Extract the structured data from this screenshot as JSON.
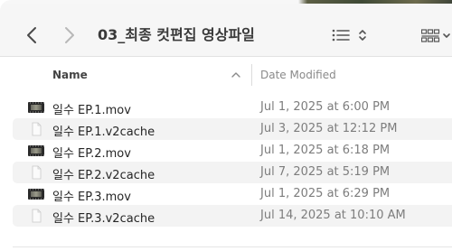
{
  "toolbar": {
    "title": "03_최종 컷편집 영상파일",
    "back_icon": "chevron-left-icon",
    "forward_icon": "chevron-right-icon",
    "list_view_icon": "list-view-icon",
    "sort_icon": "chevron-updown-icon",
    "gallery_view_icon": "gallery-view-icon"
  },
  "columns": {
    "name": "Name",
    "date_modified": "Date Modified",
    "sort_direction_icon": "chevron-up-icon"
  },
  "files": [
    {
      "name": "일수 EP.1.mov",
      "date": "Jul 1, 2025 at 6:00 PM",
      "kind": "video",
      "icon": "video-thumbnail-icon"
    },
    {
      "name": "일수 EP.1.v2cache",
      "date": "Jul 3, 2025 at 12:12 PM",
      "kind": "document",
      "icon": "document-icon"
    },
    {
      "name": "일수 EP.2.mov",
      "date": "Jul 1, 2025 at 6:18 PM",
      "kind": "video",
      "icon": "video-thumbnail-icon"
    },
    {
      "name": "일수 EP.2.v2cache",
      "date": "Jul 7, 2025 at 5:19 PM",
      "kind": "document",
      "icon": "document-icon"
    },
    {
      "name": "일수 EP.3.mov",
      "date": "Jul 1, 2025 at 6:29 PM",
      "kind": "video",
      "icon": "video-thumbnail-icon"
    },
    {
      "name": "일수 EP.3.v2cache",
      "date": "Jul 14, 2025 at 10:10 AM",
      "kind": "document",
      "icon": "document-icon"
    }
  ],
  "colors": {
    "toolbar_bg": "#f6f6f6",
    "alt_row_bg": "#f3f3f3",
    "text": "#262626",
    "secondary_text": "#7d7d7d"
  }
}
